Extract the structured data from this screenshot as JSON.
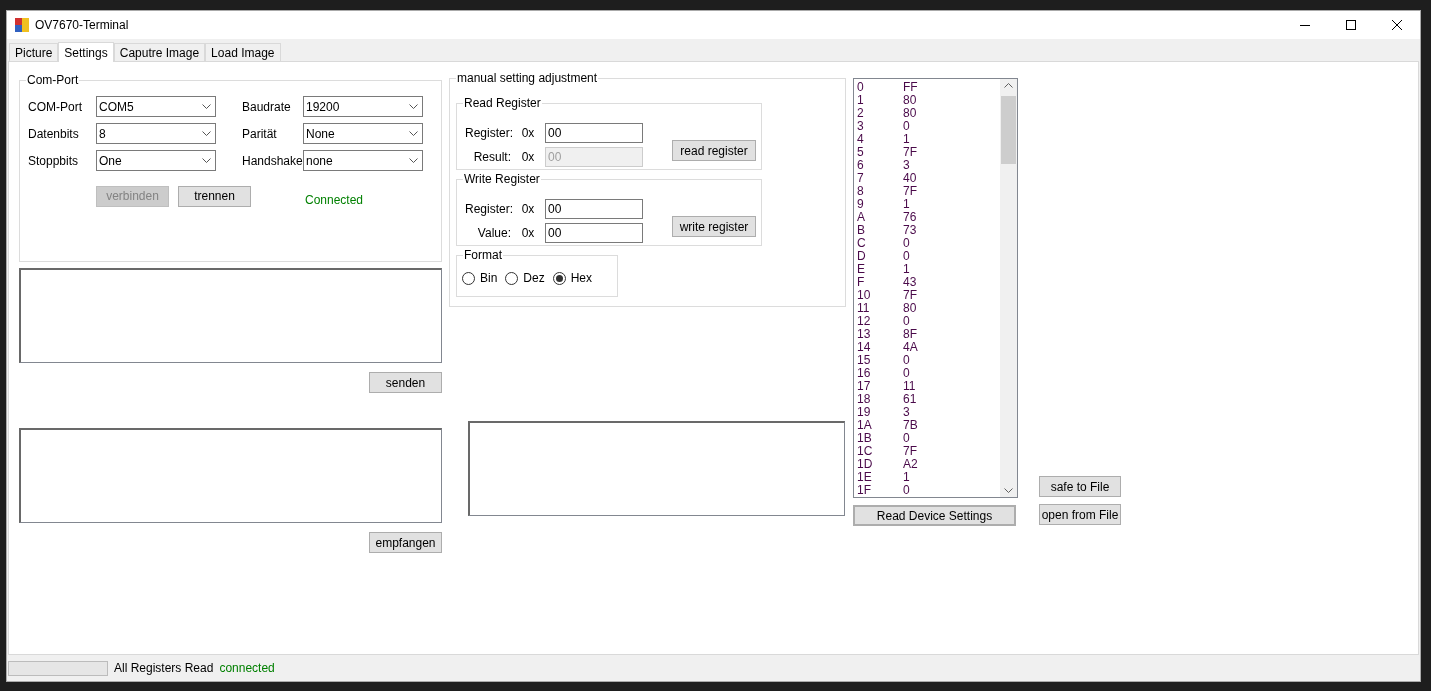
{
  "window": {
    "title": "OV7670-Terminal"
  },
  "tabs": [
    {
      "label": "Picture",
      "selected": false
    },
    {
      "label": "Settings",
      "selected": true
    },
    {
      "label": "Caputre Image",
      "selected": false
    },
    {
      "label": "Load Image",
      "selected": false
    }
  ],
  "com_port": {
    "title": "Com-Port",
    "fields": [
      {
        "label": "COM-Port",
        "value": "COM5"
      },
      {
        "label": "Baudrate",
        "value": "19200"
      },
      {
        "label": "Datenbits",
        "value": "8"
      },
      {
        "label": "Parität",
        "value": "None"
      },
      {
        "label": "Stoppbits",
        "value": "One"
      },
      {
        "label": "Handshake",
        "value": "none"
      }
    ],
    "buttons": [
      {
        "label": "verbinden",
        "disabled": true
      },
      {
        "label": "trennen",
        "disabled": false
      }
    ],
    "status": "Connected"
  },
  "send_button": "senden",
  "receive_button": "empfangen",
  "manual": {
    "title": "manual setting adjustment",
    "groups": [
      {
        "title": "Read Register",
        "rows": [
          {
            "label": "Register:",
            "prefix": "0x",
            "value": "00",
            "disabled": false
          },
          {
            "label": "Result:",
            "prefix": "0x",
            "value": "00",
            "disabled": true
          }
        ],
        "button": "read register"
      },
      {
        "title": "Write Register",
        "rows": [
          {
            "label": "Register:",
            "prefix": "0x",
            "value": "00",
            "disabled": false
          },
          {
            "label": "Value:",
            "prefix": "0x",
            "value": "00",
            "disabled": false
          }
        ],
        "button": "write register"
      }
    ],
    "format": {
      "title": "Format",
      "options": [
        {
          "label": "Bin",
          "selected": false
        },
        {
          "label": "Dez",
          "selected": false
        },
        {
          "label": "Hex",
          "selected": true
        }
      ]
    }
  },
  "registers": [
    {
      "address": "0",
      "value": "FF"
    },
    {
      "address": "1",
      "value": "80"
    },
    {
      "address": "2",
      "value": "80"
    },
    {
      "address": "3",
      "value": "0"
    },
    {
      "address": "4",
      "value": "1"
    },
    {
      "address": "5",
      "value": "7F"
    },
    {
      "address": "6",
      "value": "3"
    },
    {
      "address": "7",
      "value": "40"
    },
    {
      "address": "8",
      "value": "7F"
    },
    {
      "address": "9",
      "value": "1"
    },
    {
      "address": "A",
      "value": "76"
    },
    {
      "address": "B",
      "value": "73"
    },
    {
      "address": "C",
      "value": "0"
    },
    {
      "address": "D",
      "value": "0"
    },
    {
      "address": "E",
      "value": "1"
    },
    {
      "address": "F",
      "value": "43"
    },
    {
      "address": "10",
      "value": "7F"
    },
    {
      "address": "11",
      "value": "80"
    },
    {
      "address": "12",
      "value": "0"
    },
    {
      "address": "13",
      "value": "8F"
    },
    {
      "address": "14",
      "value": "4A"
    },
    {
      "address": "15",
      "value": "0"
    },
    {
      "address": "16",
      "value": "0"
    },
    {
      "address": "17",
      "value": "11"
    },
    {
      "address": "18",
      "value": "61"
    },
    {
      "address": "19",
      "value": "3"
    },
    {
      "address": "1A",
      "value": "7B"
    },
    {
      "address": "1B",
      "value": "0"
    },
    {
      "address": "1C",
      "value": "7F"
    },
    {
      "address": "1D",
      "value": "A2"
    },
    {
      "address": "1E",
      "value": "1"
    },
    {
      "address": "1F",
      "value": "0"
    }
  ],
  "read_device_button": "Read Device Settings",
  "file_buttons": [
    "safe to File",
    "open from File"
  ],
  "status_bar": {
    "progress": {
      "level": 0
    },
    "message": "All Registers Read",
    "connection": "connected"
  }
}
